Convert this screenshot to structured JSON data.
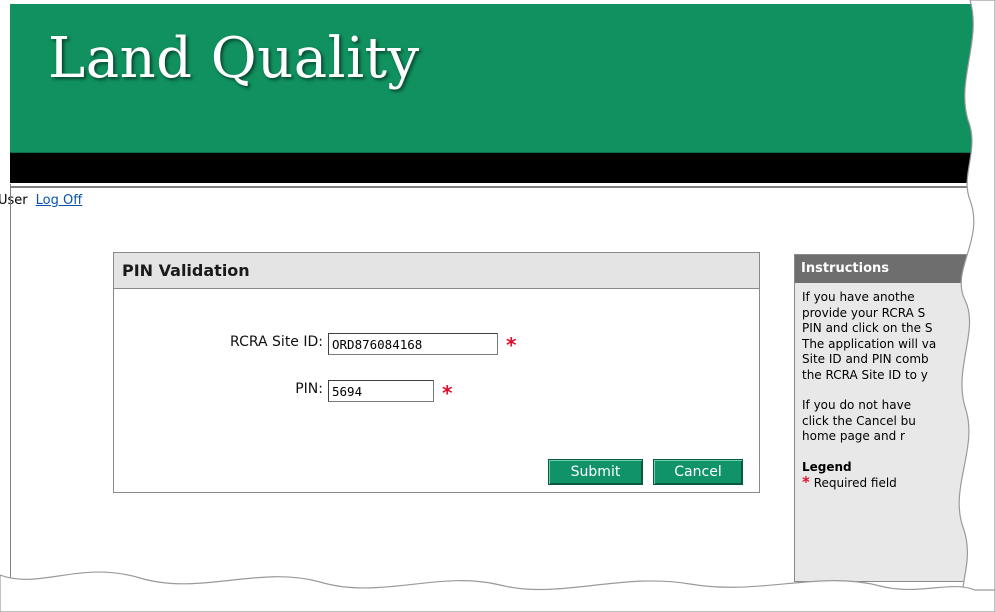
{
  "banner": {
    "title": "Land Quality"
  },
  "user_bar": {
    "user_text": "User",
    "logoff_label": "Log Off"
  },
  "pin_validation": {
    "title": "PIN Validation",
    "site_id_label": "RCRA Site ID:",
    "site_id_value": "ORD876084168",
    "pin_label": "PIN:",
    "pin_value": "5694",
    "required_marker": "*",
    "submit_label": "Submit",
    "cancel_label": "Cancel"
  },
  "instructions": {
    "title": "Instructions",
    "lines_p1": [
      "If you have anothe",
      "provide your RCRA S",
      "PIN and click on the S",
      "The application will va",
      "Site ID and PIN comb",
      "the RCRA Site ID to y"
    ],
    "lines_p2": [
      "If you do not have",
      "click the Cancel bu",
      "home page and r"
    ],
    "legend_title": "Legend",
    "legend_marker": "*",
    "legend_text": "Required field"
  },
  "colors": {
    "banner_green": "#10915f",
    "button_green": "#11936a",
    "required_red": "#e0102a",
    "link_blue": "#0a52a8"
  }
}
